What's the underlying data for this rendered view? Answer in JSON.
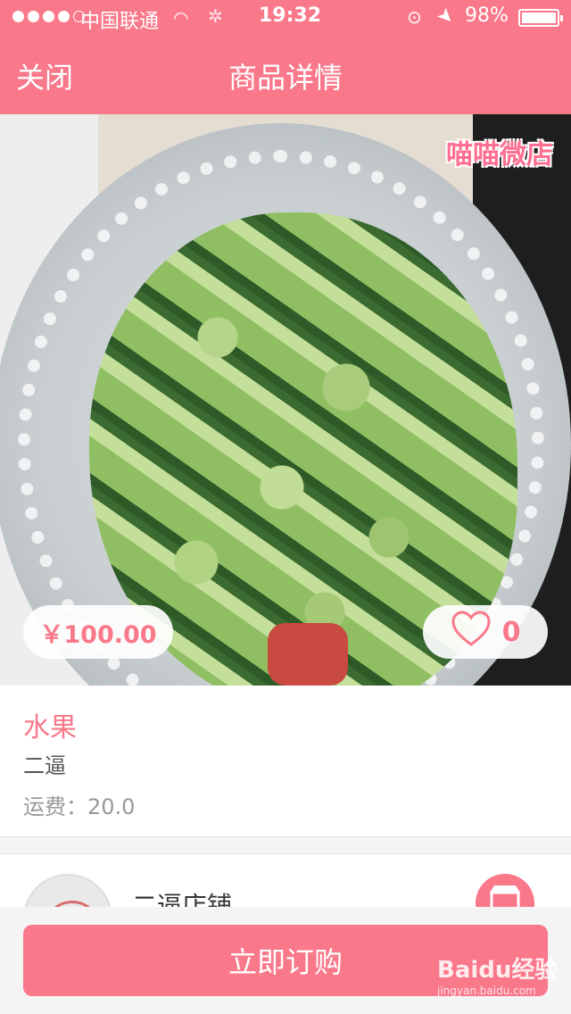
{
  "status_bar": {
    "carrier": "中国联通",
    "time": "19:32",
    "battery": "98%"
  },
  "nav": {
    "close_label": "关闭",
    "title": "商品详情"
  },
  "product": {
    "shop_logo_text": "喵喵微店",
    "price": "￥100.00",
    "likes": "0",
    "name": "水果",
    "description": "二逼",
    "shipping": "运费：20.0"
  },
  "shop": {
    "name": "二逼店铺"
  },
  "actions": {
    "buy_label": "立即订购"
  },
  "watermark": {
    "brand": "Baidu经验",
    "url": "jingyan.baidu.com"
  },
  "colors": {
    "accent": "#f9788a"
  }
}
